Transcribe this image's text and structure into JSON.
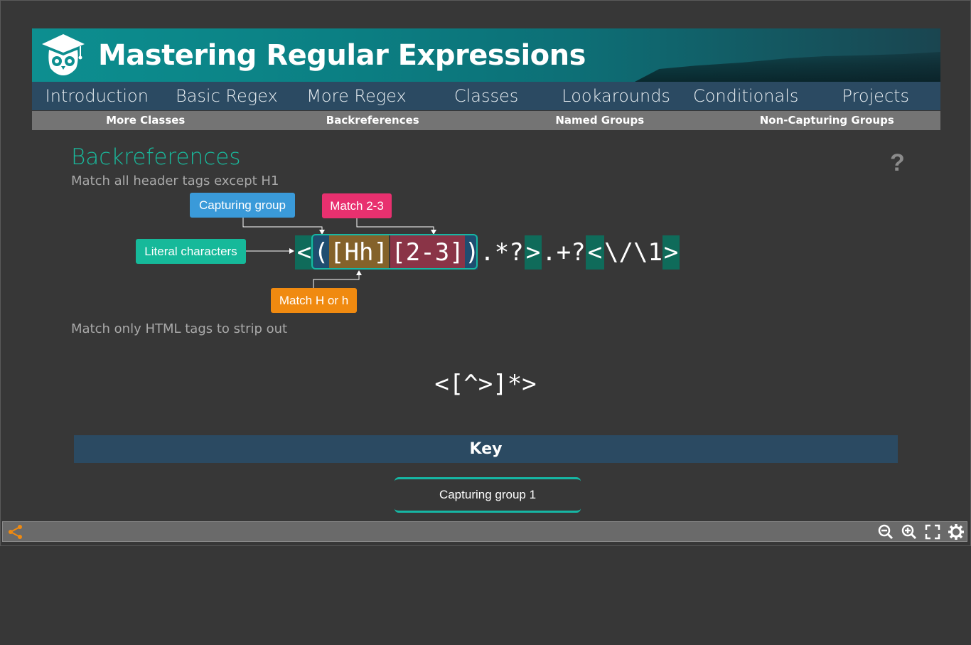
{
  "banner": {
    "title": "Mastering Regular Expressions"
  },
  "nav": {
    "items": [
      "Introduction",
      "Basic Regex",
      "More Regex",
      "Classes",
      "Lookarounds",
      "Conditionals",
      "Projects"
    ]
  },
  "subnav": {
    "items": [
      "More Classes",
      "Backreferences",
      "Named Groups",
      "Non-Capturing Groups"
    ]
  },
  "content": {
    "heading": "Backreferences",
    "subtitle1": "Match all header tags except H1",
    "subtitle2": "Match only HTML tags to strip out",
    "help": "?",
    "callouts": {
      "capturing_group": "Capturing group",
      "match_2_3": "Match 2-3",
      "literal_characters": "Literal characters",
      "match_h_or_h": "Match H or h"
    },
    "regex1": {
      "tokens": [
        "<",
        "(",
        "[Hh]",
        "[2-3]",
        ")",
        ".*?",
        ">",
        ".+?",
        "<",
        "\\/\\1",
        ">"
      ]
    },
    "regex2": "<[^>]*>"
  },
  "key": {
    "title": "Key",
    "items": [
      "Capturing group 1"
    ]
  },
  "colors": {
    "accent": "#19b99c",
    "nav_bg": "#2b4a62",
    "literal": "#0f6b5a",
    "group": "#1f4d70",
    "class_h": "#84622a",
    "class_range": "#8a3447",
    "callout_blue": "#3a9ad9",
    "callout_pink": "#e8306f",
    "callout_green": "#16b99a",
    "callout_orange": "#f08a10"
  },
  "toolbar": {
    "icons": [
      "share-icon",
      "zoom-out-icon",
      "zoom-in-icon",
      "fullscreen-icon",
      "settings-icon"
    ]
  }
}
